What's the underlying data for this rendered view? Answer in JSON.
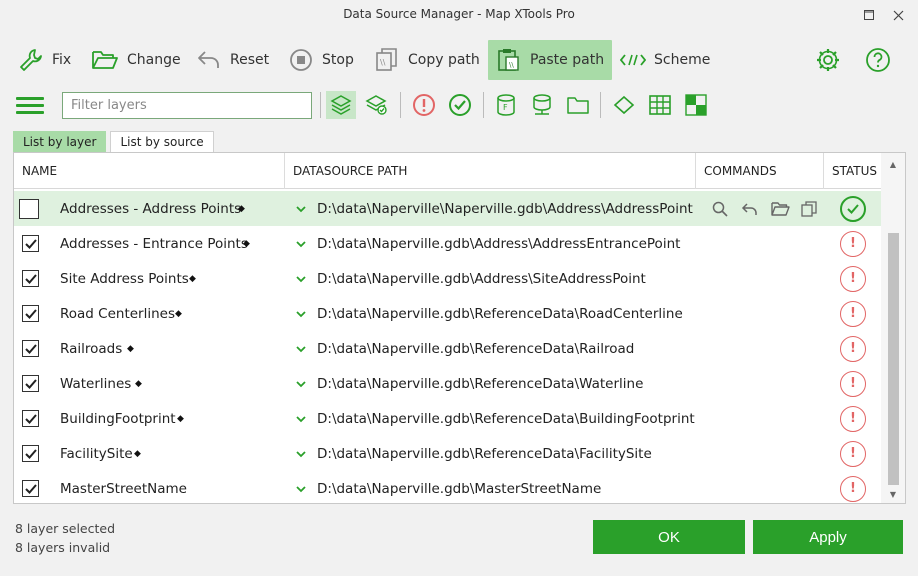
{
  "window": {
    "title": "Data Source Manager - Map   XTools Pro"
  },
  "toolbar": {
    "fix": "Fix",
    "change": "Change",
    "reset": "Reset",
    "stop": "Stop",
    "copy_path": "Copy path",
    "paste_path": "Paste path",
    "scheme": "Scheme"
  },
  "filter": {
    "placeholder": "Filter layers",
    "value": ""
  },
  "tabs": {
    "by_layer": "List by layer",
    "by_source": "List by source"
  },
  "grid": {
    "headers": {
      "name": "NAME",
      "path": "DATASOURCE PATH",
      "commands": "COMMANDS",
      "status": "STATUS"
    },
    "rows": [
      {
        "name": "Addresses - Address Points",
        "path": "D:\\data\\Naperville\\Naperville.gdb\\Address\\AddressPoint",
        "checked": false,
        "status": "ok"
      },
      {
        "name": "Addresses - Entrance Points",
        "path": "D:\\data\\Naperville.gdb\\Address\\AddressEntrancePoint",
        "checked": true,
        "status": "error"
      },
      {
        "name": "Site Address Points",
        "path": "D:\\data\\Naperville.gdb\\Address\\SiteAddressPoint",
        "checked": true,
        "status": "error"
      },
      {
        "name": "Road Centerlines",
        "path": "D:\\data\\Naperville.gdb\\ReferenceData\\RoadCenterline",
        "checked": true,
        "status": "error"
      },
      {
        "name": "Railroads",
        "path": "D:\\data\\Naperville.gdb\\ReferenceData\\Railroad",
        "checked": true,
        "status": "error"
      },
      {
        "name": "Waterlines",
        "path": "D:\\data\\Naperville.gdb\\ReferenceData\\Waterline",
        "checked": true,
        "status": "error"
      },
      {
        "name": "BuildingFootprint",
        "path": "D:\\data\\Naperville.gdb\\ReferenceData\\BuildingFootprint",
        "checked": true,
        "status": "error"
      },
      {
        "name": "FacilitySite",
        "path": "D:\\data\\Naperville.gdb\\ReferenceData\\FacilitySite",
        "checked": true,
        "status": "error"
      },
      {
        "name": "MasterStreetName",
        "path": "D:\\data\\Naperville.gdb\\MasterStreetName",
        "checked": true,
        "status": "error"
      }
    ]
  },
  "footer": {
    "selected": "8 layer selected",
    "invalid": "8 layers invalid"
  },
  "buttons": {
    "ok": "OK",
    "apply": "Apply"
  },
  "colors": {
    "accent": "#2aa02a",
    "active_bg": "#a8dba7",
    "error": "#e26565",
    "selected_row": "#dff1df"
  }
}
